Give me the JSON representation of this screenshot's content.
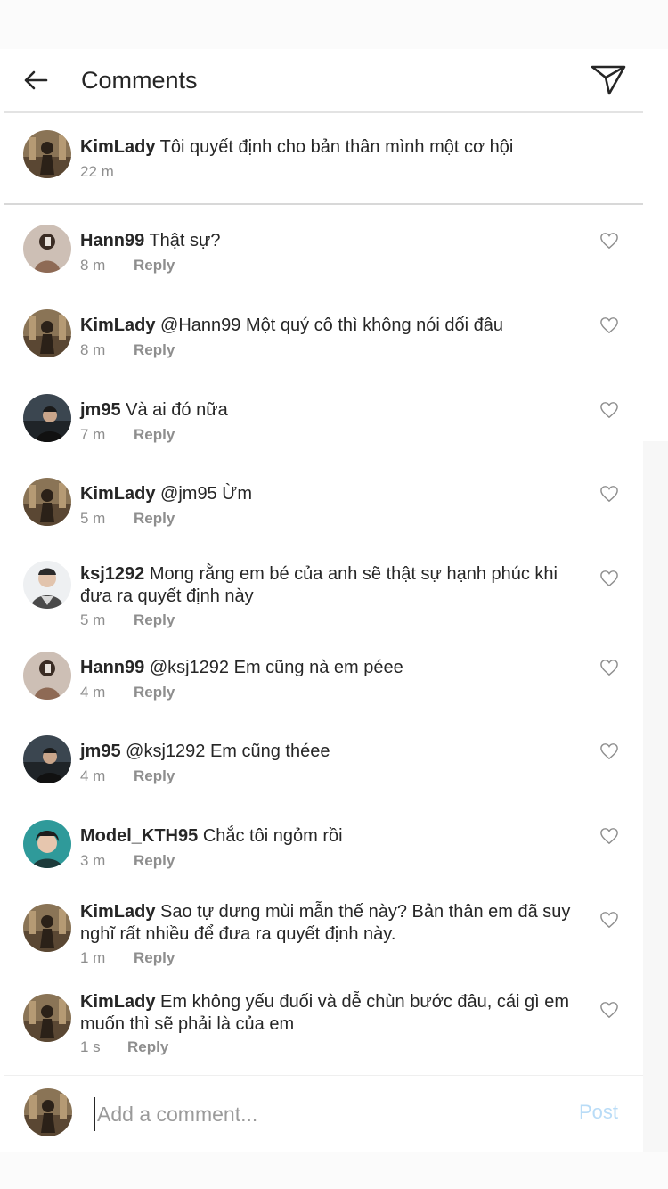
{
  "header": {
    "title": "Comments"
  },
  "caption": {
    "user": "KimLady",
    "text": "Tôi quyết định cho bản thân mình một cơ hội",
    "time": "22 m"
  },
  "reply_label": "Reply",
  "comments": [
    {
      "user": "Hann99",
      "text": "Thật sự?",
      "time": "8 m",
      "avatar": "hann"
    },
    {
      "user": "KimLady",
      "text": "@Hann99 Một quý cô thì không nói dối đâu",
      "time": "8 m",
      "avatar": "kim"
    },
    {
      "user": "jm95",
      "text": "Và ai đó nữa",
      "time": "7 m",
      "avatar": "jm"
    },
    {
      "user": "KimLady",
      "text": "@jm95 Ừm",
      "time": "5 m",
      "avatar": "kim"
    },
    {
      "user": "ksj1292",
      "text": "Mong rằng em bé của anh sẽ thật sự hạnh phúc khi đưa ra quyết định này",
      "time": "5 m",
      "avatar": "ksj"
    },
    {
      "user": "Hann99",
      "text": "@ksj1292 Em cũng nà em péee",
      "time": "4 m",
      "avatar": "hann"
    },
    {
      "user": "jm95",
      "text": "@ksj1292 Em cũng théee",
      "time": "4 m",
      "avatar": "jm"
    },
    {
      "user": "Model_KTH95",
      "text": "Chắc tôi ngỏm rồi",
      "time": "3 m",
      "avatar": "kth"
    },
    {
      "user": "KimLady",
      "text": "Sao tự dưng mùi mẫn thế này? Bản thân em đã suy nghĩ rất nhiều để đưa ra quyết định này.",
      "time": "1 m",
      "avatar": "kim"
    },
    {
      "user": "KimLady",
      "text": "Em không yếu đuối và dễ chùn bước đâu, cái gì em muốn thì sẽ phải là của em",
      "time": "1 s",
      "avatar": "kim"
    }
  ],
  "composer": {
    "placeholder": "Add a comment...",
    "post_label": "Post"
  },
  "colors": {
    "text": "#262626",
    "meta": "#8e8e8e",
    "post": "#b9dcf7",
    "divider": "#e3e3e3"
  }
}
